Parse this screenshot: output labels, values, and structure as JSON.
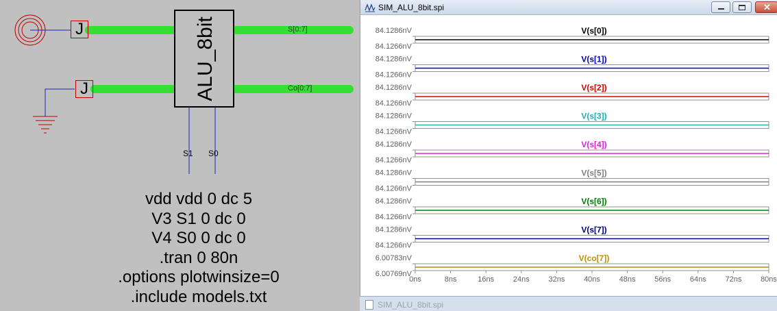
{
  "schematic": {
    "block_name": "ALU_8bit",
    "outputs": [
      "S[0:7]",
      "Co[0:7]"
    ],
    "inputs": [
      "S1",
      "S0"
    ],
    "jumper_label": "J",
    "netlist": [
      "vdd vdd 0 dc 5",
      "V3 S1 0 dc 0",
      "V4 S0 0 dc 0",
      ".tran 0 80n",
      ".options plotwinsize=0",
      ".include models.txt"
    ]
  },
  "window": {
    "title": "SIM_ALU_8bit.spi",
    "second_title": "SIM_ALU_8bit.spi",
    "icon": "waveform-icon"
  },
  "chart_data": {
    "type": "line",
    "xlabel": "",
    "x_ticks": [
      "0ns",
      "8ns",
      "16ns",
      "24ns",
      "32ns",
      "40ns",
      "48ns",
      "56ns",
      "64ns",
      "72ns",
      "80ns"
    ],
    "xlim": [
      0,
      80
    ],
    "grid": false,
    "series": [
      {
        "name": "V(s[0])",
        "color": "#000000",
        "y_ticks": [
          "84.1286nV",
          "84.1266nV"
        ],
        "ylim": [
          84.1266,
          84.1286
        ],
        "y_units": "nV",
        "values": [
          84.1276,
          84.1276
        ],
        "x": [
          0,
          80
        ],
        "label_color": "#000000"
      },
      {
        "name": "V(s[1])",
        "color": "#0000c0",
        "y_ticks": [
          "84.1286nV",
          "84.1266nV"
        ],
        "ylim": [
          84.1266,
          84.1286
        ],
        "y_units": "nV",
        "values": [
          84.1276,
          84.1276
        ],
        "x": [
          0,
          80
        ],
        "label_color": "#0000c0"
      },
      {
        "name": "V(s[2])",
        "color": "#e00000",
        "y_ticks": [
          "84.1286nV",
          "84.1266nV"
        ],
        "ylim": [
          84.1266,
          84.1286
        ],
        "y_units": "nV",
        "values": [
          84.1276,
          84.1276
        ],
        "x": [
          0,
          80
        ],
        "label_color": "#e00000"
      },
      {
        "name": "V(s[3])",
        "color": "#20b0b0",
        "y_ticks": [
          "84.1286nV",
          "84.1266nV"
        ],
        "ylim": [
          84.1266,
          84.1286
        ],
        "y_units": "nV",
        "values": [
          84.1276,
          84.1276
        ],
        "x": [
          0,
          80
        ],
        "label_color": "#20b0b0"
      },
      {
        "name": "V(s[4])",
        "color": "#e020e0",
        "y_ticks": [
          "84.1286nV",
          "84.1266nV"
        ],
        "ylim": [
          84.1266,
          84.1286
        ],
        "y_units": "nV",
        "values": [
          84.1276,
          84.1276
        ],
        "x": [
          0,
          80
        ],
        "label_color": "#e020e0"
      },
      {
        "name": "V(s[5])",
        "color": "#808080",
        "y_ticks": [
          "84.1286nV",
          "84.1266nV"
        ],
        "ylim": [
          84.1266,
          84.1286
        ],
        "y_units": "nV",
        "values": [
          84.1276,
          84.1276
        ],
        "x": [
          0,
          80
        ],
        "label_color": "#808080"
      },
      {
        "name": "V(s[6])",
        "color": "#008000",
        "y_ticks": [
          "84.1286nV",
          "84.1266nV"
        ],
        "ylim": [
          84.1266,
          84.1286
        ],
        "y_units": "nV",
        "values": [
          84.1276,
          84.1276
        ],
        "x": [
          0,
          80
        ],
        "label_color": "#008000"
      },
      {
        "name": "V(s[7])",
        "color": "#000080",
        "y_ticks": [
          "84.1286nV",
          "84.1266nV"
        ],
        "ylim": [
          84.1266,
          84.1286
        ],
        "y_units": "nV",
        "values": [
          84.1276,
          84.1276
        ],
        "x": [
          0,
          80
        ],
        "label_color": "#000080"
      },
      {
        "name": "V(co[7])",
        "color": "#b08c10",
        "y_ticks": [
          "6.00783nV",
          "6.00769nV"
        ],
        "ylim": [
          6.00769,
          6.00783
        ],
        "y_units": "nV",
        "values": [
          6.00776,
          6.00776
        ],
        "x": [
          0,
          80
        ],
        "label_color": "#c09000"
      }
    ]
  }
}
